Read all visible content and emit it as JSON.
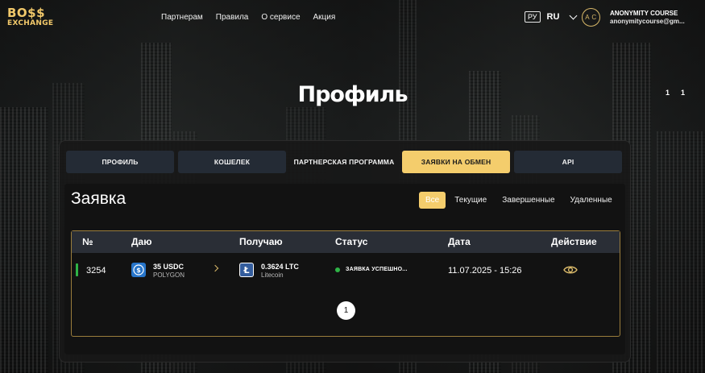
{
  "header": {
    "logo_line1": "BO$$",
    "logo_line2": "EXCHANGE",
    "nav": [
      "Партнерам",
      "Правила",
      "О сервисе",
      "Акция"
    ],
    "lang_badge": "РУ",
    "lang_code": "RU",
    "avatar_initials": "A C",
    "user_name": "ANONYMITY COURSE",
    "user_email": "anonymitycourse@gm..."
  },
  "side_numbers": [
    "1",
    "1"
  ],
  "page_title": "Профиль",
  "tabs": [
    {
      "label": "ПРОФИЛЬ",
      "active": false
    },
    {
      "label": "КОШЕЛЕК",
      "active": false
    },
    {
      "label": "ПАРТНЕРСКАЯ ПРОГРАММА",
      "active": false
    },
    {
      "label": "ЗАЯВКИ НА ОБМЕН",
      "active": true
    },
    {
      "label": "API",
      "active": false
    }
  ],
  "section_title": "Заявка",
  "filters": {
    "all": "Все",
    "current": "Текущие",
    "completed": "Завершенные",
    "deleted": "Удаленные",
    "selected": "Все"
  },
  "table": {
    "headers": [
      "№",
      "Даю",
      "Получаю",
      "Статус",
      "Дата",
      "Действие"
    ],
    "rows": [
      {
        "id": "3254",
        "give_amount": "35 USDC",
        "give_network": "POLYGON",
        "get_amount": "0.3624 LTC",
        "get_network": "Litecoin",
        "status": "ЗАЯВКА УСПЕШНО...",
        "date": "11.07.2025 - 15:26",
        "action_icon": "eye-icon"
      }
    ]
  },
  "pagination": {
    "current_page": "1"
  },
  "colors": {
    "accent": "#f4cd6c",
    "status_green": "#2fb447",
    "usdc_blue": "#2775ca",
    "ltc_blue": "#345d9d"
  }
}
